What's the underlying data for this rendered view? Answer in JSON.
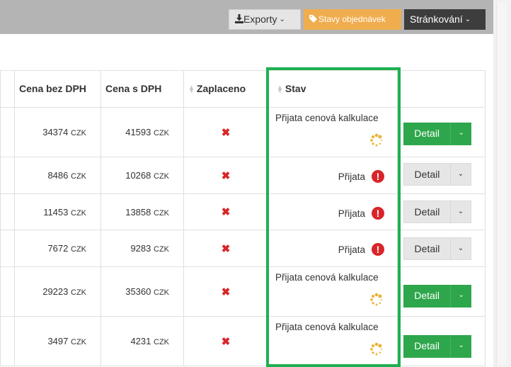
{
  "toolbar": {
    "export_label": "Exporty",
    "order_states_label": "Stavy objednávek",
    "paging_label": "Stránkování"
  },
  "table": {
    "headers": {
      "price_no_vat": "Cena bez DPH",
      "price_vat": "Cena s DPH",
      "paid": "Zaplaceno",
      "state": "Stav"
    },
    "currency": "CZK",
    "rows": [
      {
        "price_no_vat": "34374",
        "price_vat": "41593",
        "paid": "✖",
        "state": "Přijata cenová kalkulace",
        "state_kind": "kalkulace",
        "button": "Detail",
        "button_style": "green"
      },
      {
        "price_no_vat": "8486",
        "price_vat": "10268",
        "paid": "✖",
        "state": "Přijata",
        "state_kind": "prijata",
        "button": "Detail",
        "button_style": "gray"
      },
      {
        "price_no_vat": "11453",
        "price_vat": "13858",
        "paid": "✖",
        "state": "Přijata",
        "state_kind": "prijata",
        "button": "Detail",
        "button_style": "gray"
      },
      {
        "price_no_vat": "7672",
        "price_vat": "9283",
        "paid": "✖",
        "state": "Přijata",
        "state_kind": "prijata",
        "button": "Detail",
        "button_style": "gray"
      },
      {
        "price_no_vat": "29223",
        "price_vat": "35360",
        "paid": "✖",
        "state": "Přijata cenová kalkulace",
        "state_kind": "kalkulace",
        "button": "Detail",
        "button_style": "green"
      },
      {
        "price_no_vat": "3497",
        "price_vat": "4231",
        "paid": "✖",
        "state": "Přijata cenová kalkulace",
        "state_kind": "kalkulace",
        "button": "Detail",
        "button_style": "green"
      }
    ]
  },
  "icons": {
    "export": "download-icon",
    "order_states": "tag-icon",
    "sort": "sort-icon",
    "paid_no": "x-mark-icon",
    "warning": "exclamation-circle-icon",
    "loading": "spinner-icon",
    "dropdown": "chevron-down-icon"
  },
  "colors": {
    "green": "#2ea64b",
    "orange": "#f0ad4e",
    "dark": "#3d3d3d",
    "red": "#d9252a",
    "highlight": "#1eb050",
    "spinner": "#e8b63a"
  }
}
